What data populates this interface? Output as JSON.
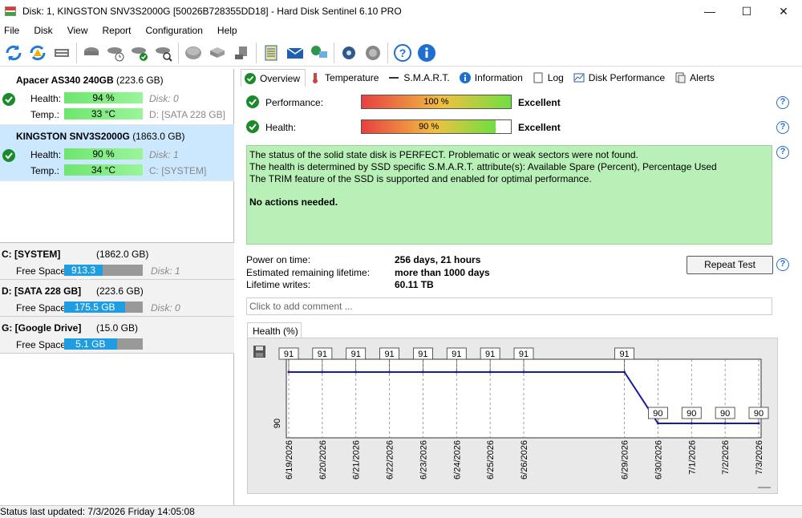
{
  "window": {
    "title": "Disk: 1, KINGSTON SNV3S2000G [50026B728355DD18]  -  Hard Disk Sentinel 6.10 PRO",
    "minimize": "—",
    "maximize": "☐",
    "close": "✕"
  },
  "menu": [
    "File",
    "Disk",
    "View",
    "Report",
    "Configuration",
    "Help"
  ],
  "disks": [
    {
      "name": "Apacer AS340 240GB",
      "size": "(223.6 GB)",
      "health_label": "Health:",
      "health": "94 %",
      "health_value": 94,
      "temp_label": "Temp.:",
      "temp": "33 °C",
      "disk_no": "Disk: 0",
      "volume": "D: [SATA 228 GB]"
    },
    {
      "name": "KINGSTON SNV3S2000G",
      "size": "(1863.0 GB)",
      "health_label": "Health:",
      "health": "90 %",
      "health_value": 90,
      "temp_label": "Temp.:",
      "temp": "34 °C",
      "disk_no": "Disk: 1",
      "volume": "C: [SYSTEM]"
    }
  ],
  "volumes": [
    {
      "name": "C: [SYSTEM]",
      "size": "(1862.0 GB)",
      "free_label": "Free Space",
      "free": "913.3 GB",
      "free_fraction": 0.49,
      "disk": "Disk: 1"
    },
    {
      "name": "D: [SATA 228 GB]",
      "size": "(223.6 GB)",
      "free_label": "Free Space",
      "free": "175.5 GB",
      "free_fraction": 0.78,
      "disk": "Disk: 0"
    },
    {
      "name": "G: [Google Drive]",
      "size": "(15.0 GB)",
      "free_label": "Free Space",
      "free": "5.1 GB",
      "free_fraction": 0.67,
      "disk": ""
    }
  ],
  "tabs": [
    "Overview",
    "Temperature",
    "S.M.A.R.T.",
    "Information",
    "Log",
    "Disk Performance",
    "Alerts"
  ],
  "overview": {
    "performance_label": "Performance:",
    "performance": "100 %",
    "performance_value": 100,
    "performance_rating": "Excellent",
    "health_label": "Health:",
    "health": "90 %",
    "health_value": 90,
    "health_rating": "Excellent",
    "status_lines": [
      "The status of the solid state disk is PERFECT. Problematic or weak sectors were not found.",
      "The health is determined by SSD specific S.M.A.R.T. attribute(s):  Available Spare (Percent), Percentage Used",
      "The TRIM feature of the SSD is supported and enabled for optimal performance."
    ],
    "status_action": "No actions needed.",
    "power_on_label": "Power on time:",
    "power_on": "256 days, 21 hours",
    "lifetime_label": "Estimated remaining lifetime:",
    "lifetime": "more than 1000 days",
    "writes_label": "Lifetime writes:",
    "writes": "60.11 TB",
    "repeat_test": "Repeat Test",
    "comment_placeholder": "Click to add comment ..."
  },
  "chart_data": {
    "type": "line",
    "tab_label": "Health (%)",
    "ylabel": "90",
    "x": [
      "6/19/2026",
      "6/20/2026",
      "6/21/2026",
      "6/22/2026",
      "6/23/2026",
      "6/24/2026",
      "6/25/2026",
      "6/26/2026",
      "6/29/2026",
      "6/30/2026",
      "7/1/2026",
      "7/2/2026",
      "7/3/2026"
    ],
    "series": [
      {
        "values": [
          91,
          91,
          91,
          91,
          91,
          91,
          91,
          91,
          91,
          90,
          90,
          90,
          90
        ]
      }
    ],
    "ylim": [
      90,
      91
    ],
    "grid": true,
    "line_color": "#1a1aa0"
  },
  "statusbar": "Status last updated: 7/3/2026 Friday 14:05:08"
}
